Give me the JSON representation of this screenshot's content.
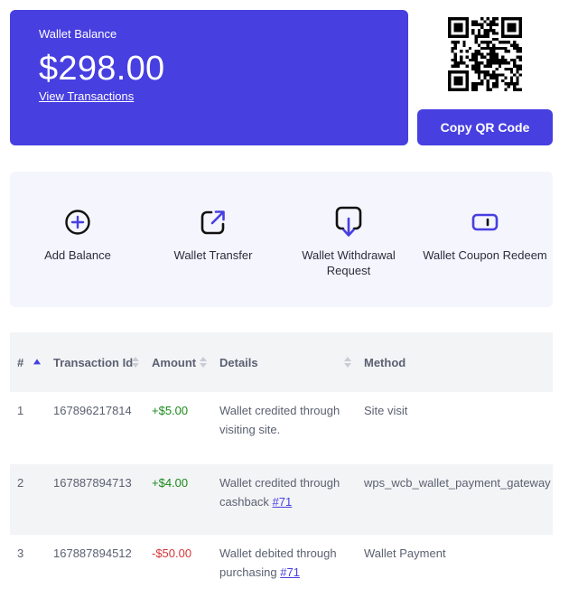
{
  "wallet": {
    "balance_label": "Wallet Balance",
    "balance_amount": "$298.00",
    "view_transactions": "View Transactions",
    "copy_qr": "Copy QR Code"
  },
  "actions": [
    {
      "label": "Add Balance",
      "icon": "plus-circle-icon"
    },
    {
      "label": "Wallet Transfer",
      "icon": "external-link-icon"
    },
    {
      "label": "Wallet Withdrawal Request",
      "icon": "withdraw-arrow-icon"
    },
    {
      "label": "Wallet Coupon Redeem",
      "icon": "coupon-icon"
    }
  ],
  "table": {
    "headers": [
      "#",
      "Transaction Id",
      "Amount",
      "Details",
      "Method"
    ],
    "rows": [
      {
        "n": "1",
        "id": "167896217814",
        "amount": "+$5.00",
        "details": "Wallet credited through visiting site.",
        "link": "",
        "method": "Site visit"
      },
      {
        "n": "2",
        "id": "167887894713",
        "amount": "+$4.00",
        "details": "Wallet credited through cashback",
        "link": "#71",
        "method": "wps_wcb_wallet_payment_gateway"
      },
      {
        "n": "3",
        "id": "167887894512",
        "amount": "-$50.00",
        "details": "Wallet debited through purchasing",
        "link": "#71",
        "method": "Wallet Payment"
      }
    ]
  },
  "colors": {
    "accent": "#473fe0",
    "positive": "#1a8a1a",
    "negative": "#d63638",
    "panel": "#f5f5fd"
  }
}
